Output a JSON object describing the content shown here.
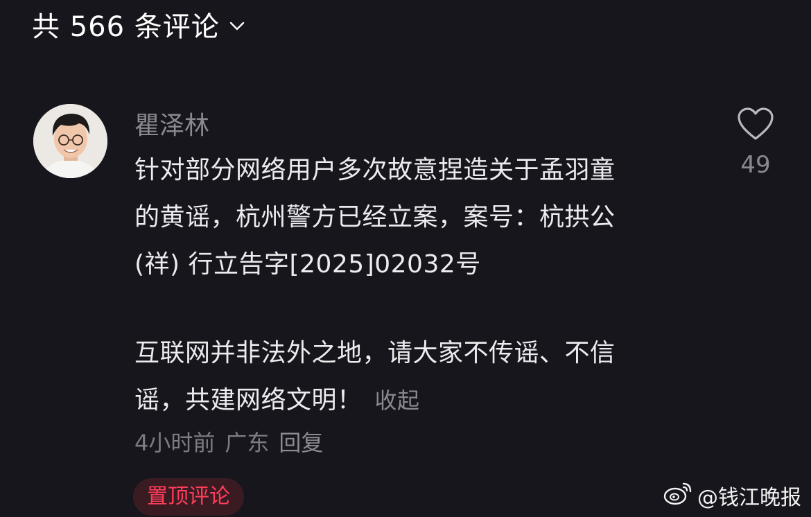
{
  "header": {
    "title": "共 566 条评论",
    "chevron_icon": "chevron-down-icon"
  },
  "comment": {
    "avatar_icon": "user-avatar",
    "username": "瞿泽林",
    "lines": [
      "针对部分网络用户多次故意捏造关于孟羽童",
      "的黄谣，杭州警方已经立案，案号：杭拱公",
      "(祥) 行立告字[2025]02032号"
    ],
    "lines2": [
      "互联网并非法外之地，请大家不传谣、不信",
      "谣，共建网络文明！"
    ],
    "collapse_label": "收起",
    "time": "4小时前",
    "location": "广东",
    "reply_label": "回复",
    "pinned_label": "置顶评论",
    "like_icon": "heart-icon",
    "like_count": "49"
  },
  "watermark": {
    "text": "@钱江晚报",
    "icon": "weibo-logo"
  },
  "colors": {
    "background": "#17161c",
    "pinned_text": "#ff3d5a",
    "pinned_bg": "#3a1b22",
    "muted_text": "#8a8990"
  }
}
